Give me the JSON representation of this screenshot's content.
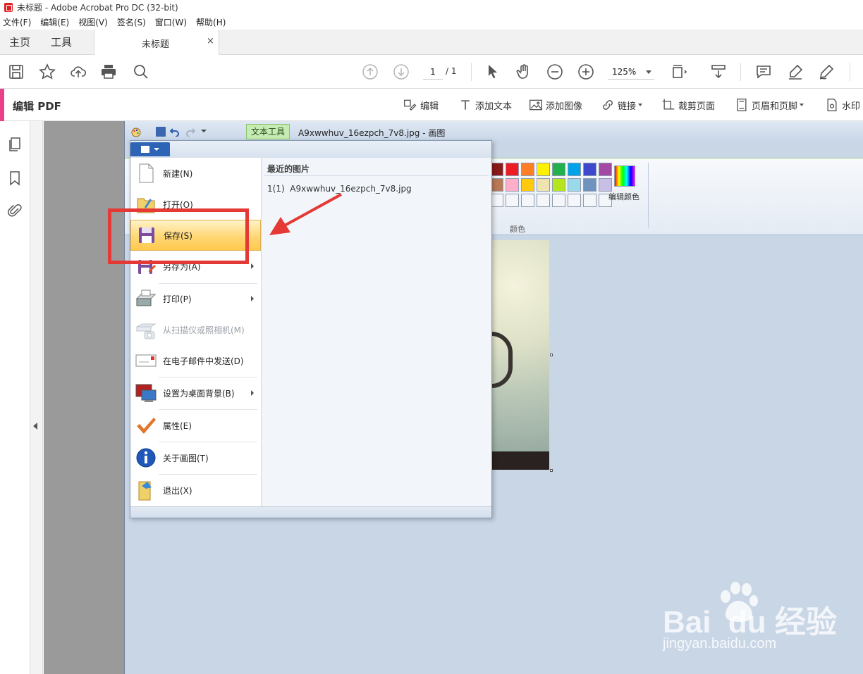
{
  "window": {
    "title": "未标题 - Adobe Acrobat Pro DC (32-bit)"
  },
  "menubar": [
    "文件(F)",
    "编辑(E)",
    "视图(V)",
    "签名(S)",
    "窗口(W)",
    "帮助(H)"
  ],
  "tabs": {
    "home": "主页",
    "tools": "工具",
    "document": "未标题",
    "close": "×"
  },
  "toolbar": {
    "page_current": "1",
    "page_total": "/ 1",
    "zoom": "125%"
  },
  "editpdf": {
    "title": "编辑 PDF",
    "tools": [
      "编辑",
      "添加文本",
      "添加图像",
      "链接",
      "裁剪页面",
      "页眉和页脚",
      "水印"
    ]
  },
  "paint": {
    "context_tab": "文本工具",
    "window_title": "A9xwwhuv_16ezpch_7v8.jpg - 画图",
    "color_group_label": "颜色",
    "edit_colors_label": "编辑颜色",
    "palette_row1": [
      "#8b1a1a",
      "#ed1c24",
      "#ff7f27",
      "#fff200",
      "#22b14c",
      "#00a2e8",
      "#3f48cc",
      "#a349a4"
    ],
    "palette_row2": [
      "#b97a57",
      "#ffaec9",
      "#ffc90e",
      "#efe4b0",
      "#b5e61d",
      "#99d9ea",
      "#7092be",
      "#c8bfe7"
    ]
  },
  "filemenu": {
    "items": [
      {
        "label": "新建(N)",
        "icon": "new-file-icon",
        "submenu": false,
        "disabled": false
      },
      {
        "label": "打开(O)",
        "icon": "open-folder-icon",
        "submenu": false,
        "disabled": false
      },
      {
        "label": "保存(S)",
        "icon": "save-icon",
        "submenu": false,
        "disabled": false,
        "highlighted": true
      },
      {
        "label": "另存为(A)",
        "icon": "save-as-icon",
        "submenu": true,
        "disabled": false
      },
      {
        "label": "打印(P)",
        "icon": "printer-icon",
        "submenu": true,
        "disabled": false
      },
      {
        "label": "从扫描仪或照相机(M)",
        "icon": "scanner-icon",
        "submenu": false,
        "disabled": true
      },
      {
        "label": "在电子邮件中发送(D)",
        "icon": "email-icon",
        "submenu": false,
        "disabled": false
      },
      {
        "label": "设置为桌面背景(B)",
        "icon": "desktop-icon",
        "submenu": true,
        "disabled": false
      },
      {
        "label": "属性(E)",
        "icon": "checkmark-icon",
        "submenu": false,
        "disabled": false
      },
      {
        "label": "关于画图(T)",
        "icon": "info-icon",
        "submenu": false,
        "disabled": false
      },
      {
        "label": "退出(X)",
        "icon": "exit-icon",
        "submenu": false,
        "disabled": false
      }
    ],
    "recent_header": "最近的图片",
    "recent_items": [
      "1(1)  A9xwwhuv_16ezpch_7v8.jpg"
    ]
  },
  "watermark": {
    "brand": "Bai  du 经验",
    "url": "jingyan.baidu.com"
  },
  "colors": {
    "accent_pink": "#e8418a",
    "annotation_red": "#e53935",
    "menu_highlight": "#ffd775"
  }
}
